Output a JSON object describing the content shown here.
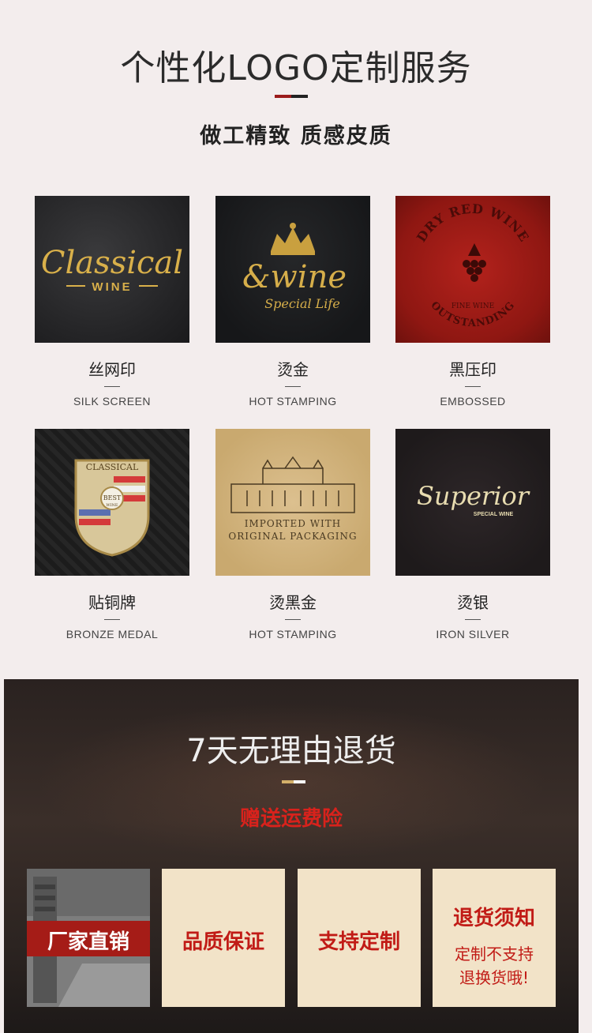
{
  "header": {
    "title": "个性化LOGO定制服务",
    "subtitle": "做工精致 质感皮质"
  },
  "crafts": [
    {
      "cn": "丝网印",
      "en": "SILK SCREEN",
      "sample_text": [
        "Classical",
        "WINE"
      ]
    },
    {
      "cn": "烫金",
      "en": "HOT STAMPING",
      "sample_text": [
        "&wine",
        "Special Life"
      ]
    },
    {
      "cn": "黑压印",
      "en": "EMBOSSED",
      "sample_text": [
        "DRY RED WINE",
        "FINE WINE",
        "OUTSTANDING"
      ]
    },
    {
      "cn": "贴铜牌",
      "en": "BRONZE MEDAL",
      "sample_text": [
        "CLASSICAL",
        "BEST",
        "WINE"
      ]
    },
    {
      "cn": "烫黑金",
      "en": "HOT STAMPING",
      "sample_text": [
        "IMPORTED WITH",
        "ORIGINAL PACKAGING"
      ]
    },
    {
      "cn": "烫银",
      "en": "IRON SILVER",
      "sample_text": [
        "Superior",
        "SPECIAL WINE"
      ]
    }
  ],
  "returns": {
    "title": "7天无理由退货",
    "subtitle": "赠送运费险",
    "cards": [
      "厂家直销",
      "品质保证",
      "支持定制"
    ],
    "notice_title": "退货须知",
    "notice_lines": [
      "定制不支持",
      "退换货哦!"
    ]
  },
  "colors": {
    "accent_red": "#c11b16",
    "gold": "#d4b06a",
    "card_bg": "#f2e3c8",
    "page_bg": "#f3eded"
  }
}
